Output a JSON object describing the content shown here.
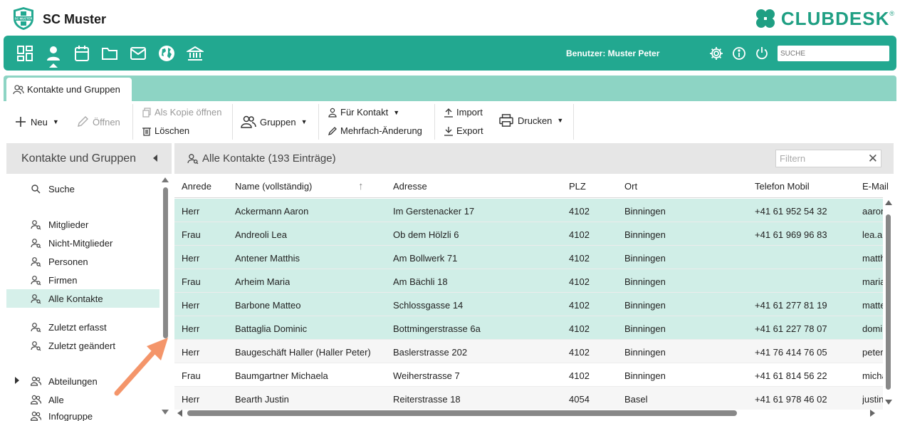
{
  "header": {
    "club_name": "SC Muster",
    "club_logo_text": "SC MUSTER",
    "brand_name": "CLUBDESK",
    "brand_reg": "®"
  },
  "navbar": {
    "icons": [
      "dashboard-icon",
      "person-icon",
      "calendar-icon",
      "folder-icon",
      "mail-icon",
      "globe-icon",
      "bank-icon"
    ],
    "user_label": "Benutzer: Muster Peter",
    "search_placeholder": "SUCHE",
    "accent": "#22a890"
  },
  "tabs": [
    {
      "label": "Kontakte und Gruppen",
      "icon": "contacts-icon"
    }
  ],
  "toolbar": {
    "new_label": "Neu",
    "open_label": "Öffnen",
    "copy_open_label": "Als Kopie öffnen",
    "delete_label": "Löschen",
    "groups_label": "Gruppen",
    "for_contact_label": "Für Kontakt",
    "multi_edit_label": "Mehrfach-Änderung",
    "import_label": "Import",
    "export_label": "Export",
    "print_label": "Drucken"
  },
  "sidebar": {
    "title": "Kontakte und Gruppen",
    "items": [
      {
        "label": "Suche",
        "icon": "search-icon"
      },
      {
        "label": "Mitglieder",
        "icon": "contact-search-icon"
      },
      {
        "label": "Nicht-Mitglieder",
        "icon": "contact-search-icon"
      },
      {
        "label": "Personen",
        "icon": "contact-search-icon"
      },
      {
        "label": "Firmen",
        "icon": "contact-search-icon"
      },
      {
        "label": "Alle Kontakte",
        "icon": "contact-search-icon",
        "active": true
      },
      {
        "label": "Zuletzt erfasst",
        "icon": "contact-search-icon"
      },
      {
        "label": "Zuletzt geändert",
        "icon": "contact-search-icon"
      },
      {
        "label": "Abteilungen",
        "icon": "group-icon"
      },
      {
        "label": "Alle",
        "icon": "group-icon"
      },
      {
        "label": "Infogruppe",
        "icon": "group-icon"
      }
    ]
  },
  "main": {
    "title": "Alle Kontakte (193 Einträge)",
    "filter_placeholder": "Filtern",
    "columns": [
      "Anrede",
      "Name (vollständig)",
      "Adresse",
      "PLZ",
      "Ort",
      "Telefon Mobil",
      "E-Mail"
    ],
    "rows": [
      {
        "anrede": "Herr",
        "name": "Ackermann Aaron",
        "adresse": "Im Gerstenacker 17",
        "plz": "4102",
        "ort": "Binningen",
        "tel": "+41 61 952 54 32",
        "email": "aaron",
        "selected": true
      },
      {
        "anrede": "Frau",
        "name": "Andreoli Lea",
        "adresse": "Ob dem Hölzli 6",
        "plz": "4102",
        "ort": "Binningen",
        "tel": "+41 61 969 96 83",
        "email": "lea.ar",
        "selected": true
      },
      {
        "anrede": "Herr",
        "name": "Antener Matthis",
        "adresse": "Am Bollwerk 71",
        "plz": "4102",
        "ort": "Binningen",
        "tel": "",
        "email": "matth",
        "selected": true
      },
      {
        "anrede": "Frau",
        "name": "Arheim Maria",
        "adresse": "Am Bächli 18",
        "plz": "4102",
        "ort": "Binningen",
        "tel": "",
        "email": "maria",
        "selected": true
      },
      {
        "anrede": "Herr",
        "name": "Barbone Matteo",
        "adresse": "Schlossgasse 14",
        "plz": "4102",
        "ort": "Binningen",
        "tel": "+41 61 277 81 19",
        "email": "matte",
        "selected": true
      },
      {
        "anrede": "Herr",
        "name": "Battaglia Dominic",
        "adresse": "Bottmingerstrasse 6a",
        "plz": "4102",
        "ort": "Binningen",
        "tel": "+41 61 227 78 07",
        "email": "domi",
        "selected": true
      },
      {
        "anrede": "Herr",
        "name": "Baugeschäft Haller (Haller Peter)",
        "adresse": "Baslerstrasse 202",
        "plz": "4102",
        "ort": "Binningen",
        "tel": "+41 76 414 76 05",
        "email": "peter",
        "selected": false
      },
      {
        "anrede": "Frau",
        "name": "Baumgartner Michaela",
        "adresse": "Weiherstrasse 7",
        "plz": "4102",
        "ort": "Binningen",
        "tel": "+41 61 814 56 22",
        "email": "micha",
        "selected": false
      },
      {
        "anrede": "Herr",
        "name": "Bearth Justin",
        "adresse": "Reiterstrasse 18",
        "plz": "4054",
        "ort": "Basel",
        "tel": "+41 61 978 46 02",
        "email": "justin",
        "selected": false
      }
    ]
  },
  "colors": {
    "brand_green": "#1f9f83",
    "tab_strip": "#8dd4c4",
    "selection": "#d0eee7",
    "annotation_arrow": "#f4956a"
  }
}
